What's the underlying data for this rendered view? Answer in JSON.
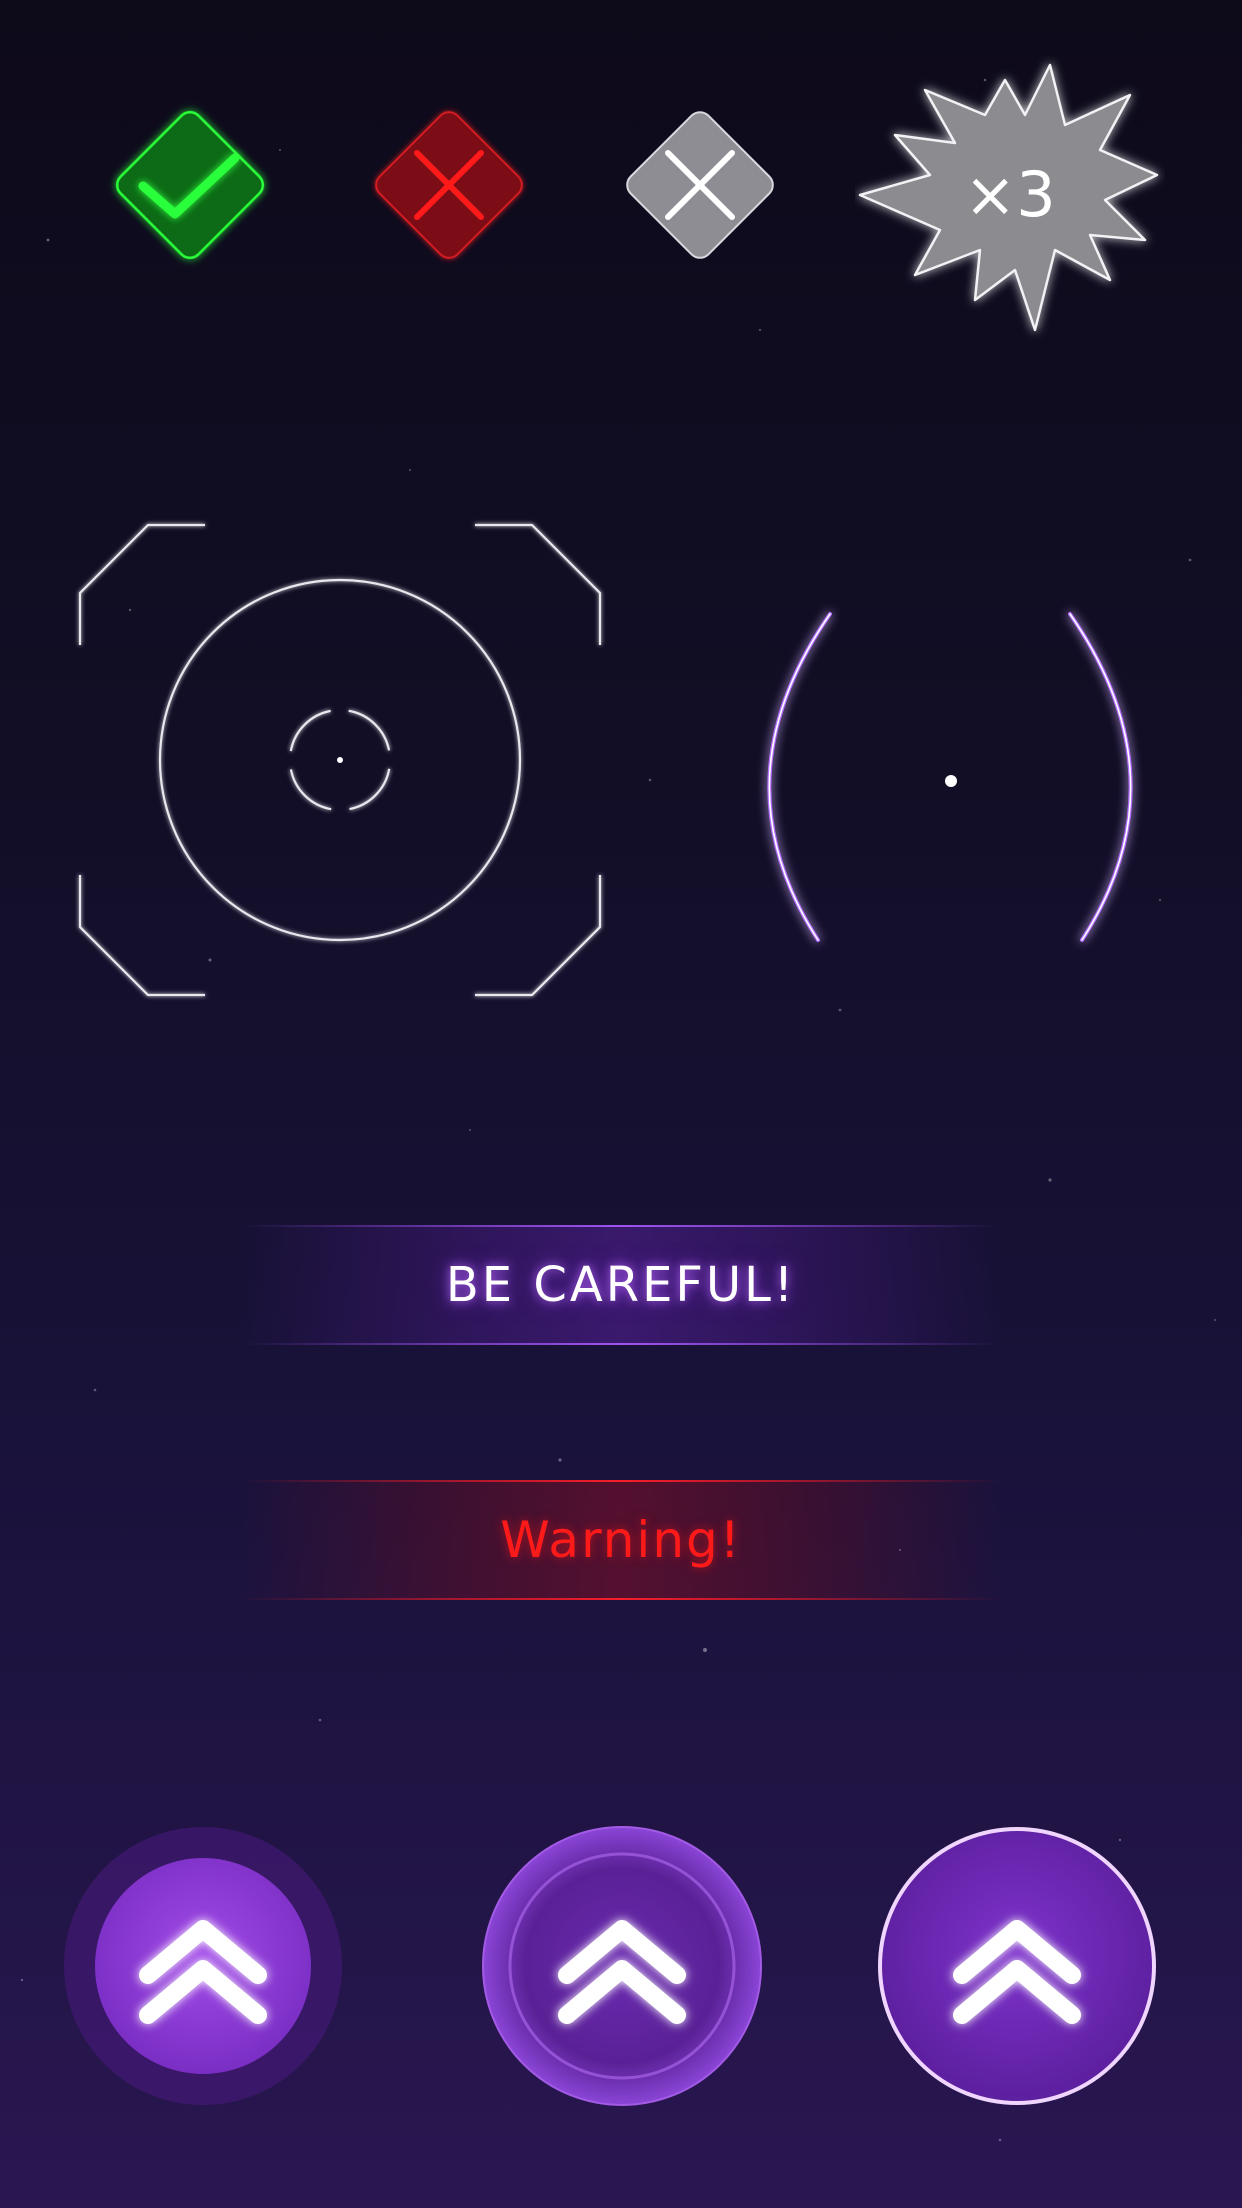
{
  "icons": {
    "check_icon": "checkmark-icon",
    "red_x_icon": "close-icon",
    "gray_x_icon": "close-icon"
  },
  "multiplier_badge": {
    "text": "×3"
  },
  "banners": {
    "careful_text": "BE CAREFUL!",
    "warning_text": "Warning!"
  },
  "up_buttons": {
    "icon": "double-chevron-up-icon"
  },
  "colors": {
    "green": "#1ee61e",
    "red": "#ff1a1a",
    "gray": "#bdbdc4",
    "purple": "#a03fe6",
    "background": "#120e26"
  }
}
